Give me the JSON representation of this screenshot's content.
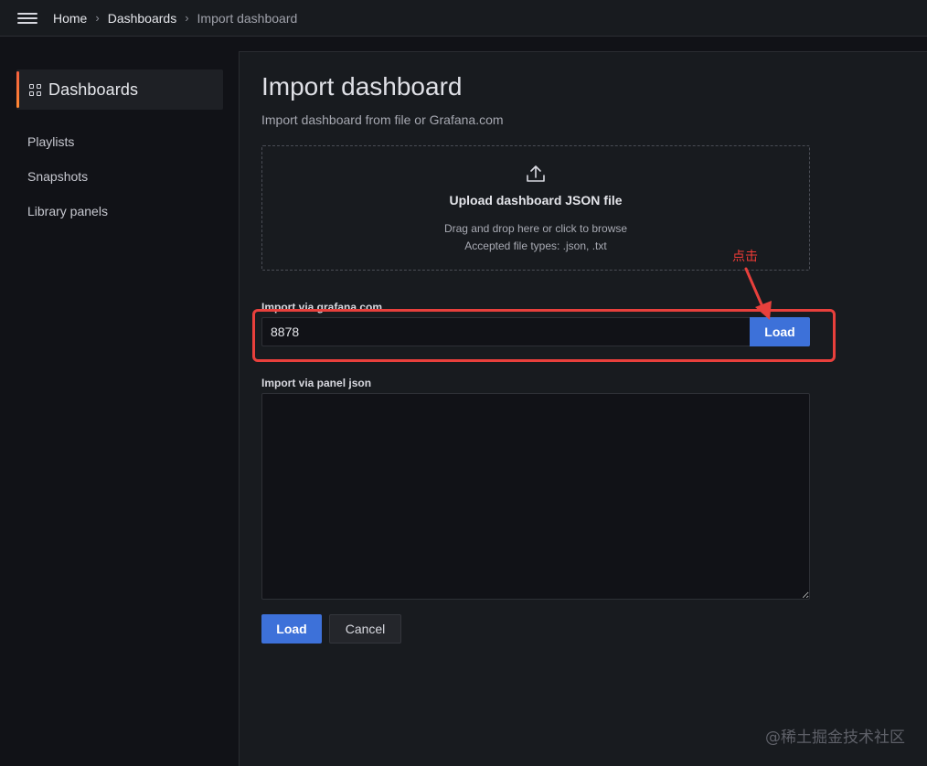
{
  "breadcrumb": {
    "home": "Home",
    "dashboards": "Dashboards",
    "current": "Import dashboard",
    "separator": "›"
  },
  "sidebar": {
    "title": "Dashboards",
    "title_icon": "grid-icon",
    "items": [
      {
        "label": "Playlists"
      },
      {
        "label": "Snapshots"
      },
      {
        "label": "Library panels"
      }
    ]
  },
  "page": {
    "title": "Import dashboard",
    "subtitle": "Import dashboard from file or Grafana.com"
  },
  "upload": {
    "icon": "upload-icon",
    "title": "Upload dashboard JSON file",
    "hint_line1": "Drag and drop here or click to browse",
    "hint_line2": "Accepted file types: .json, .txt"
  },
  "grafana_com": {
    "label": "Import via grafana.com",
    "value": "8878",
    "load_label": "Load"
  },
  "panel_json": {
    "label": "Import via panel json",
    "value": ""
  },
  "footer": {
    "load_label": "Load",
    "cancel_label": "Cancel"
  },
  "annotation": {
    "text": "点击",
    "color": "#e8403c"
  },
  "watermark": "@稀土掘金技术社区",
  "colors": {
    "primary": "#3d71d9",
    "accent_gradient_start": "#f55f3e",
    "accent_gradient_end": "#ff8833"
  }
}
